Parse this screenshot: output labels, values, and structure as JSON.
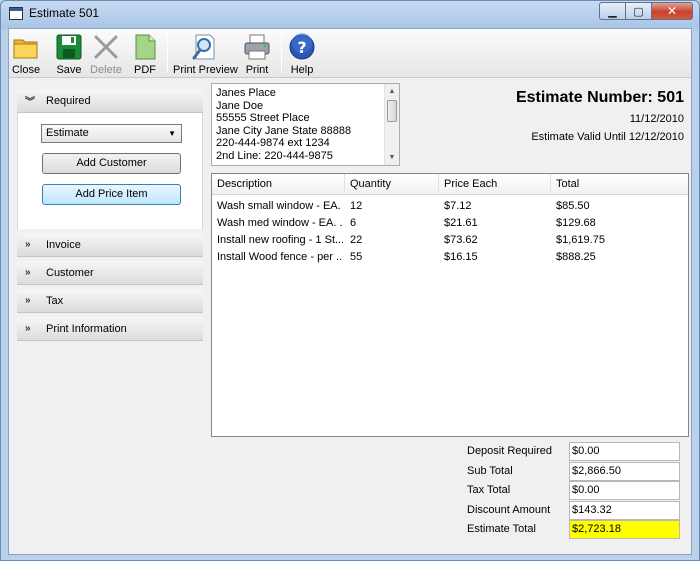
{
  "window": {
    "title": "Estimate 501"
  },
  "toolbar": {
    "close_label": "Close",
    "save_label": "Save",
    "delete_label": "Delete",
    "pdf_label": "PDF",
    "print_preview_label": "Print Preview",
    "print_label": "Print",
    "help_label": "Help"
  },
  "sidebar": {
    "required_label": "Required",
    "type_select_value": "Estimate",
    "add_customer_label": "Add Customer",
    "add_price_item_label": "Add Price Item",
    "sections": [
      "Invoice",
      "Customer",
      "Tax",
      "Print Information"
    ]
  },
  "address": {
    "lines": [
      "Janes Place",
      "Jane Doe",
      "55555 Street Place",
      "Jane City Jane State 88888",
      "220-444-9874 ext 1234",
      "2nd Line: 220-444-9875"
    ]
  },
  "estimate": {
    "number_text": "Estimate Number: 501",
    "date": "11/12/2010",
    "valid_text": "Estimate Valid Until 12/12/2010"
  },
  "grid": {
    "columns": [
      "Description",
      "Quantity",
      "Price Each",
      "Total"
    ],
    "rows": [
      [
        "Wash small window - EA.",
        "12",
        "$7.12",
        "$85.50"
      ],
      [
        "Wash med window - EA. ...",
        "6",
        "$21.61",
        "$129.68"
      ],
      [
        "Install new roofing - 1 St...",
        "22",
        "$73.62",
        "$1,619.75"
      ],
      [
        "Install Wood fence -  per ...",
        "55",
        "$16.15",
        "$888.25"
      ]
    ]
  },
  "totals": {
    "deposit_label": "Deposit Required",
    "deposit_value": "$0.00",
    "subtotal_label": "Sub Total",
    "subtotal_value": "$2,866.50",
    "tax_label": "Tax Total",
    "tax_value": "$0.00",
    "discount_label": "Discount Amount",
    "discount_value": "$143.32",
    "estimate_total_label": "Estimate Total",
    "estimate_total_value": "$2,723.18",
    "highlight_color": "#ffff00"
  },
  "icons": {
    "close": "folder-icon",
    "save": "floppy-disk-icon",
    "delete": "x-mark-icon",
    "pdf": "document-icon",
    "print_preview": "magnifier-document-icon",
    "print": "printer-icon",
    "help": "question-mark-icon"
  }
}
